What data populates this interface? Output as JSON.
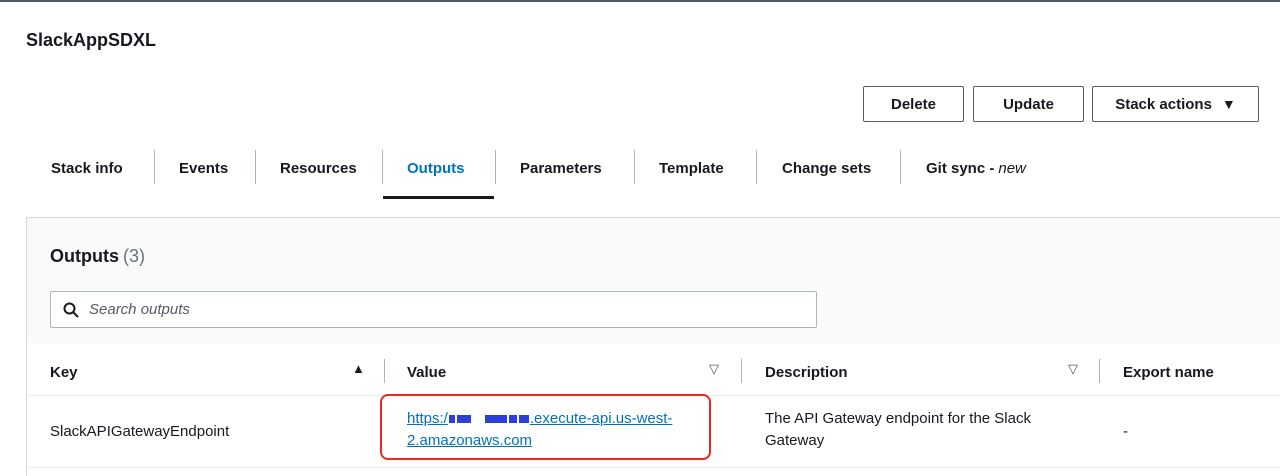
{
  "stack": {
    "title": "SlackAppSDXL"
  },
  "actions": {
    "delete_label": "Delete",
    "update_label": "Update",
    "stack_actions_label": "Stack actions",
    "caret": "▼"
  },
  "tabs": [
    {
      "label": "Stack info",
      "active": false
    },
    {
      "label": "Events",
      "active": false
    },
    {
      "label": "Resources",
      "active": false
    },
    {
      "label": "Outputs",
      "active": true
    },
    {
      "label": "Parameters",
      "active": false
    },
    {
      "label": "Template",
      "active": false
    },
    {
      "label": "Change sets",
      "active": false
    },
    {
      "label": "Git sync - ",
      "suffix": "new",
      "active": false
    }
  ],
  "outputs": {
    "title": "Outputs",
    "count": "(3)",
    "search_placeholder": "Search outputs",
    "columns": {
      "key": "Key",
      "value": "Value",
      "description": "Description",
      "export_name": "Export name"
    },
    "sort_icons": {
      "key": "▲",
      "value": "▽",
      "description": "▽"
    },
    "rows": [
      {
        "key": "SlackAPIGatewayEndpoint",
        "value_prefix": "https:/",
        "value_suffix": ".execute-api.us-west-2.amazonaws.com",
        "description": "The API Gateway endpoint for the Slack Gateway",
        "export_name": "-"
      }
    ]
  },
  "colors": {
    "accent": "#0073bb",
    "text": "#16191f",
    "highlight": "#e8291c"
  }
}
